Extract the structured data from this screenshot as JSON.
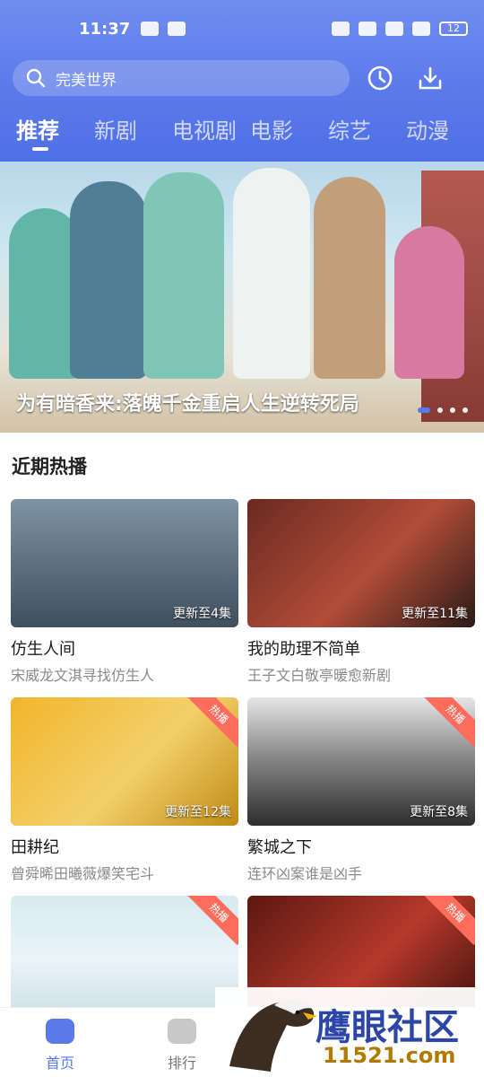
{
  "status": {
    "time": "11:37",
    "battery": "12"
  },
  "search": {
    "placeholder": "完美世界"
  },
  "tabs": [
    "推荐",
    "新剧",
    "电视剧",
    "电影",
    "综艺",
    "动漫"
  ],
  "hero": {
    "title": "为有暗香来:落魄千金重启人生逆转死局"
  },
  "section": {
    "title": "近期热播"
  },
  "cards": [
    {
      "title": "仿生人间",
      "desc": "宋威龙文淇寻找仿生人",
      "update": "更新至4集",
      "hot": ""
    },
    {
      "title": "我的助理不简单",
      "desc": "王子文白敬亭暖愈新剧",
      "update": "更新至11集",
      "hot": ""
    },
    {
      "title": "田耕纪",
      "desc": "曾舜晞田曦薇爆笑宅斗",
      "update": "更新至12集",
      "hot": "热播"
    },
    {
      "title": "繁城之下",
      "desc": "连环凶案谁是凶手",
      "update": "更新至8集",
      "hot": "热播"
    },
    {
      "title": "",
      "desc": "",
      "update": "",
      "hot": "热播"
    },
    {
      "title": "",
      "desc": "",
      "update": "",
      "hot": "热播"
    }
  ],
  "bottom_nav": [
    {
      "label": "首页"
    },
    {
      "label": "排行"
    }
  ],
  "watermark": {
    "text": "鹰眼社区",
    "sub": "11521.com"
  },
  "colors": {
    "accent": "#5a79ea",
    "hot": "#ff6c5c"
  }
}
